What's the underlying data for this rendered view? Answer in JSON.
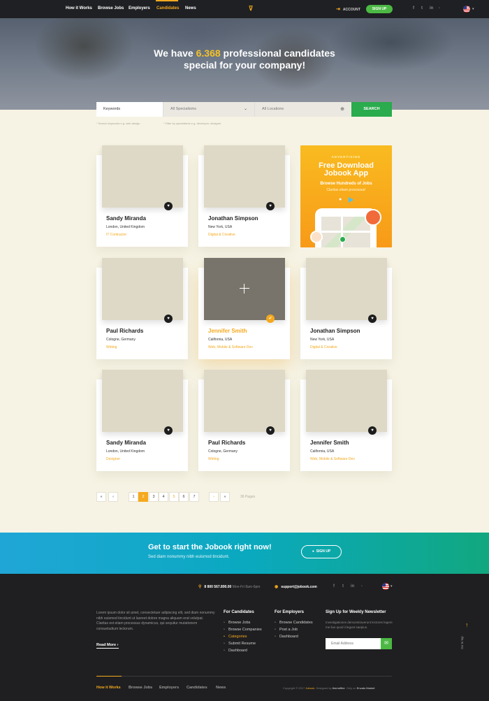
{
  "nav": {
    "items": [
      "How it Works",
      "Browse Jobs",
      "Employers",
      "Candidates",
      "News"
    ],
    "active": "Candidates",
    "account_label": "ACCOUNT",
    "signup_label": "SIGN UP",
    "social": [
      "f",
      "t",
      "in",
      "rss"
    ]
  },
  "hero": {
    "title_pre": "We have ",
    "title_count": "6.368",
    "title_post": " professional candidates",
    "title_line2": "special for your company!"
  },
  "search": {
    "keywords_placeholder": "Keywords",
    "specialisms_placeholder": "All Specialisms",
    "location_placeholder": "All Locations",
    "button_label": "SEARCH",
    "hint_keywords": "* Search keywords e.g. web design",
    "hint_specialisms": "* Filter by specialisms e.g. developer, designer"
  },
  "candidates": [
    {
      "name": "Sandy Miranda",
      "location": "London, United Kingdom",
      "category": "IT Contractor"
    },
    {
      "name": "Jonathan Simpson",
      "location": "New York, USA",
      "category": "Digital & Creative"
    },
    {
      "name": "Paul Richards",
      "location": "Cologne, Germany",
      "category": "Writing"
    },
    {
      "name": "Jennifer Smith",
      "location": "California, USA",
      "category": "Web, Mobile & Software Dev"
    },
    {
      "name": "Jonathan Simpson",
      "location": "New York, USA",
      "category": "Digital & Creative"
    },
    {
      "name": "Sandy Miranda",
      "location": "London, United Kingdom",
      "category": "Designer"
    },
    {
      "name": "Paul Richards",
      "location": "Cologne, Germany",
      "category": "Writing"
    },
    {
      "name": "Jennifer Smith",
      "location": "California, USA",
      "category": "Web, Mobile & Software Dev"
    }
  ],
  "ad": {
    "label": "ADVERTISING",
    "title_line1": "Free Download",
    "title_line2": "Jobook App",
    "sub1": "Browse Hundreds of Jobs",
    "sub2": "Claritas etiam processus!"
  },
  "pagination": {
    "pages": [
      "1",
      "2",
      "3",
      "4",
      "5",
      "6",
      "7"
    ],
    "current": "2",
    "total_label": "36 Pages"
  },
  "cta": {
    "title": "Get to start the Jobook right now!",
    "subtitle": "Sed diam nonummy nibh euismod tincidunt.",
    "button": "SIGN UP"
  },
  "footer": {
    "phone": "8 800 567.890.00",
    "phone_hours": " Mon-Fri 8am-6pm",
    "email": "support@jobook.com",
    "about": "Lorem ipsum dolor sit amet, consectetuer adipiscing elit, sed diam nonummy nibh euismod tincidunt ut laoreet dolore magna aliquam erat volutpat. Claritas est etiam processus dynamicus, qui sequitur mutationem consuetudium lectorum.",
    "read_more": "Read More",
    "col_candidates": {
      "title": "For Candidates",
      "links": [
        "Browse Jobs",
        "Browse Companies",
        "Categories",
        "Submit Resume",
        "Dashboard"
      ]
    },
    "col_employers": {
      "title": "For Employers",
      "links": [
        "Browse Candidates",
        "Post a Job",
        "Dashboard"
      ]
    },
    "newsletter": {
      "title": "Sign Up for Weekly Newsletter",
      "desc": "Investigationes demonstraverunt lectores legere me lius quod ii legunt saepius.",
      "placeholder": "Email Address"
    },
    "go_top": "Go to top",
    "bottom_nav": [
      "How it Works",
      "Browse Jobs",
      "Employers",
      "Candidates",
      "News"
    ],
    "copy_pre": "Copyright © 2017 ",
    "copy_brand": "Jobook",
    "copy_mid": ". Designed by ",
    "copy_author": "themefthe",
    "copy_mid2": ". Only on ",
    "copy_market": "Envato Market"
  },
  "colors": {
    "accent": "#f5a91e",
    "green": "#4cb944",
    "dark": "#1f2023",
    "background": "#f6f3e4"
  }
}
